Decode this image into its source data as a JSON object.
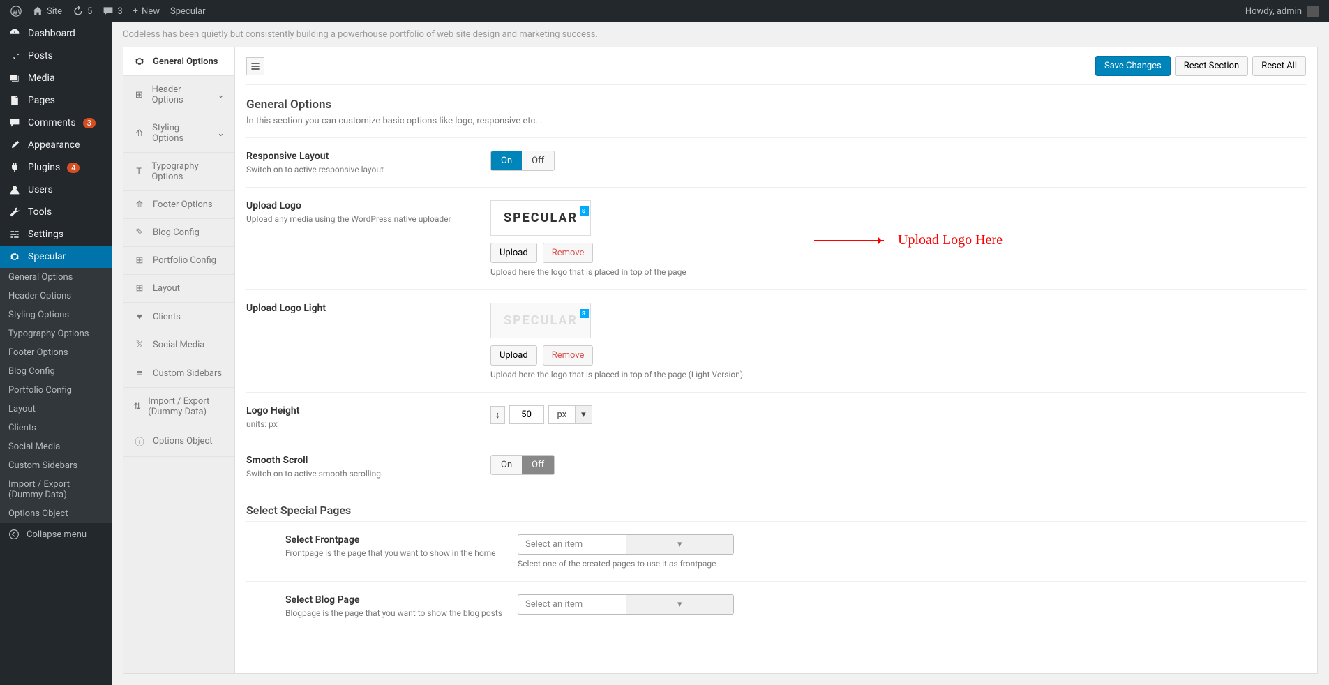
{
  "adminBar": {
    "site": "Site",
    "refresh": "5",
    "comments": "3",
    "new": "New",
    "theme": "Specular",
    "howdy": "Howdy, admin"
  },
  "sidebar": {
    "items": [
      {
        "label": "Dashboard",
        "icon": "dashboard"
      },
      {
        "label": "Posts",
        "icon": "pin"
      },
      {
        "label": "Media",
        "icon": "media"
      },
      {
        "label": "Pages",
        "icon": "page"
      },
      {
        "label": "Comments",
        "icon": "comment",
        "badge": "3"
      },
      {
        "label": "Appearance",
        "icon": "brush"
      },
      {
        "label": "Plugins",
        "icon": "plug",
        "badge": "4"
      },
      {
        "label": "Users",
        "icon": "user"
      },
      {
        "label": "Tools",
        "icon": "wrench"
      },
      {
        "label": "Settings",
        "icon": "sliders"
      },
      {
        "label": "Specular",
        "icon": "gear",
        "active": true
      }
    ],
    "sub": [
      "General Options",
      "Header Options",
      "Styling Options",
      "Typography Options",
      "Footer Options",
      "Blog Config",
      "Portfolio Config",
      "Layout",
      "Clients",
      "Social Media",
      "Custom Sidebars",
      "Import / Export (Dummy Data)",
      "Options Object"
    ],
    "collapse": "Collapse menu"
  },
  "descBar": "Codeless has been quietly but consistently building a powerhouse portfolio of web site design and marketing success.",
  "panelSidebar": [
    {
      "label": "General Options",
      "active": true
    },
    {
      "label": "Header Options",
      "expand": true
    },
    {
      "label": "Styling Options",
      "expand": true
    },
    {
      "label": "Typography Options"
    },
    {
      "label": "Footer Options"
    },
    {
      "label": "Blog Config"
    },
    {
      "label": "Portfolio Config"
    },
    {
      "label": "Layout"
    },
    {
      "label": "Clients"
    },
    {
      "label": "Social Media"
    },
    {
      "label": "Custom Sidebars"
    },
    {
      "label": "Import / Export (Dummy Data)"
    },
    {
      "label": "Options Object"
    }
  ],
  "actions": {
    "save": "Save Changes",
    "resetSection": "Reset Section",
    "resetAll": "Reset All"
  },
  "section": {
    "title": "General Options",
    "desc": "In this section you can customize basic options like logo, responsive etc..."
  },
  "fields": {
    "responsive": {
      "title": "Responsive Layout",
      "desc": "Switch on to active responsive layout",
      "on": "On",
      "off": "Off",
      "value": "on"
    },
    "uploadLogo": {
      "title": "Upload Logo",
      "desc": "Upload any media using the WordPress native uploader",
      "logoText": "SPECULAR",
      "upload": "Upload",
      "remove": "Remove",
      "help": "Upload here the logo that is placed in top of the page"
    },
    "uploadLogoLight": {
      "title": "Upload Logo Light",
      "logoText": "SPECULAR",
      "upload": "Upload",
      "remove": "Remove",
      "help": "Upload here the logo that is placed in top of the page (Light Version)"
    },
    "logoHeight": {
      "title": "Logo Height",
      "desc": "units: px",
      "value": "50",
      "unit": "px"
    },
    "smoothScroll": {
      "title": "Smooth Scroll",
      "desc": "Switch on to active smooth scrolling",
      "on": "On",
      "off": "Off",
      "value": "off"
    },
    "specialPages": {
      "title": "Select Special Pages"
    },
    "frontpage": {
      "title": "Select Frontpage",
      "desc": "Frontpage is the page that you want to show in the home",
      "placeholder": "Select an item",
      "help": "Select one of the created pages to use it as frontpage"
    },
    "blogpage": {
      "title": "Select Blog Page",
      "desc": "Blogpage is the page that you want to show the blog posts",
      "placeholder": "Select an item"
    }
  },
  "annotation": "Upload Logo Here"
}
